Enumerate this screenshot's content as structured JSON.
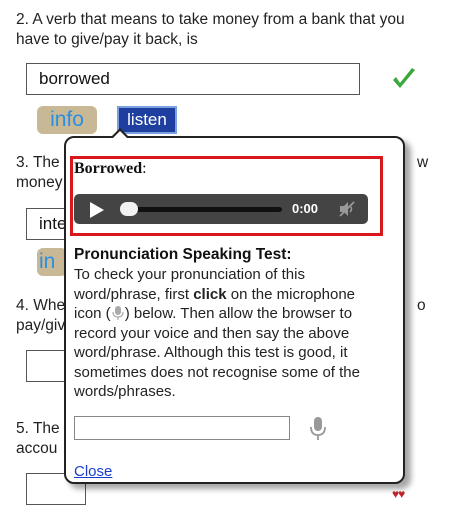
{
  "questions": [
    {
      "number": "2.",
      "line1": "2. A verb that means to take money from a bank that you",
      "line2": "have to give/pay it back, is",
      "answer": "borrowed"
    },
    {
      "line1": "3. The",
      "line1_right": "w",
      "line2": "money",
      "answer": "inte"
    },
    {
      "line1": "4. Whe",
      "line1_right": "o",
      "line2": "pay/giv"
    },
    {
      "line1": "5. The",
      "line2": "accou"
    }
  ],
  "buttons": {
    "info": "info",
    "listen": "listen",
    "info2": "in"
  },
  "popup": {
    "word": "Borrowed",
    "word_suffix": ":",
    "player_time": "0:00",
    "test_title": "Pronunciation Speaking Test:",
    "body_1": "To check your pronunciation of this word/phrase, first ",
    "body_bold": "click",
    "body_2": " on the microphone icon (",
    "body_3": ") below. Then allow the browser to record your voice and then say the above word/phrase. Although this test is good, it sometimes does not recognise some of the words/phrases.",
    "close": "Close"
  },
  "colors": {
    "check": "#3aa83a",
    "listen_bg": "#1f3fa0",
    "info_bg": "#c8b896",
    "highlight": "#d8181c"
  }
}
